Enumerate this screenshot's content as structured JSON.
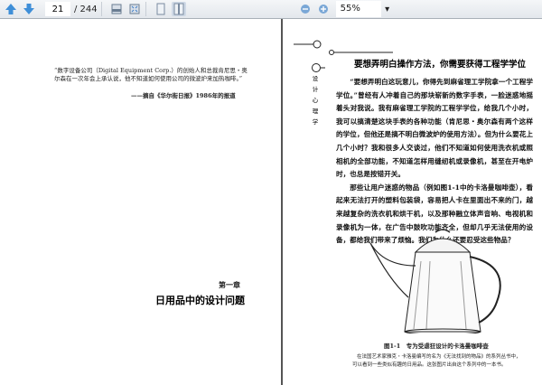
{
  "toolbar": {
    "current_page": "21",
    "total_pages": "/ 244",
    "zoom": "55%"
  },
  "left_page": {
    "quote_line1": "“数字设备公司（Digital Equipment Corp.）的创始人和总裁肯尼思・奥",
    "quote_line2": "尔森在一次年会上承认说，他不知道如何使用公司的微波炉来加热咖啡。”",
    "quote_source": "——摘自《华尔街日报》1986年的报道",
    "chapter_number": "第一章",
    "chapter_title": "日用品中的设计问题"
  },
  "right_page": {
    "side_label": [
      "设",
      "计",
      "心",
      "理",
      "学"
    ],
    "heading": "要想弄明白操作方法，你需要获得工程学学位",
    "paragraphs": [
      "“要想弄明白这玩意儿，你得先到麻省理工学院拿一个工程学学位。”曾经有人冲着自己的那块崭新的数字手表，一脸迷惑地摇着头对我说。我有麻省理工学院的工程学学位，给我几个小时，我可以搞清楚这块手表的各种功能（肯尼思・奥尔森有两个这样的学位，但他还是搞不明白微波炉的使用方法）。但为什么要花上几个小时？我和很多人交谈过，他们不知道如何使用洗衣机或照相机的全部功能，不知道怎样用缝纫机或录像机，甚至在开电炉时，也总是按错开关。",
      "那些让用户迷惑的物品（例如图1-1中的卡洛曼咖啡壶），看起来无法打开的塑料包装袋，容易把人卡在里面出不来的门，越来越复杂的洗衣机和烘干机，以及那种融立体声音响、电视机和录像机为一体，在广告中鼓吹功能齐全，但却几乎无法使用的设备，都给我们带来了烦恼。我们为什么还要忍受这些物品？"
    ],
    "figure_caption": "图1-1　专为受虐狂设计的卡洛曼咖啡壶",
    "figure_note_line1": "在法国艺术家雅克・卡洛曼编写的名为《无法找到的物品》的系列丛书中，",
    "figure_note_line2": "可以看到一些类似有趣的日用品。这张图片出自这个系列中的一本书。"
  },
  "colors": {
    "toolbar": "#e8ebef",
    "nav_arrow": "#3f8fd8",
    "divider": "#555555"
  }
}
